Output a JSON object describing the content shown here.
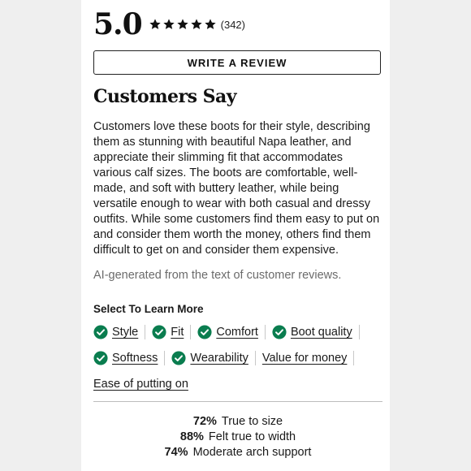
{
  "rating": {
    "score": "5.0",
    "stars": 5,
    "count": "(342)"
  },
  "write_review_label": "WRITE A REVIEW",
  "heading": "Customers Say",
  "summary": "Customers love these boots for their style, describing them as stunning with beautiful Napa leather, and appreciate their slimming fit that accommodates various calf sizes. The boots are comfortable, well-made, and soft with buttery leather, while being versatile enough to wear with both casual and dressy outfits. While some customers find them easy to put on and consider them worth the money, others find them difficult to get on and consider them expensive.",
  "disclaimer": "AI-generated from the text of customer reviews.",
  "learn_more": {
    "label": "Select To Learn More",
    "aspects": [
      {
        "label": "Style",
        "checked": true
      },
      {
        "label": "Fit",
        "checked": true
      },
      {
        "label": "Comfort",
        "checked": true
      },
      {
        "label": "Boot quality",
        "checked": true
      },
      {
        "label": "Softness",
        "checked": true
      },
      {
        "label": "Wearability",
        "checked": true
      },
      {
        "label": "Value for money",
        "checked": false
      },
      {
        "label": "Ease of putting on",
        "checked": false
      }
    ]
  },
  "fit_stats": [
    {
      "pct": "72%",
      "text": "True to size"
    },
    {
      "pct": "88%",
      "text": "Felt true to width"
    },
    {
      "pct": "74%",
      "text": "Moderate arch support"
    }
  ],
  "colors": {
    "check_green": "#0a7d4f",
    "star": "#111111"
  },
  "icons": {
    "star": "star-icon",
    "check": "check-circle-icon"
  }
}
